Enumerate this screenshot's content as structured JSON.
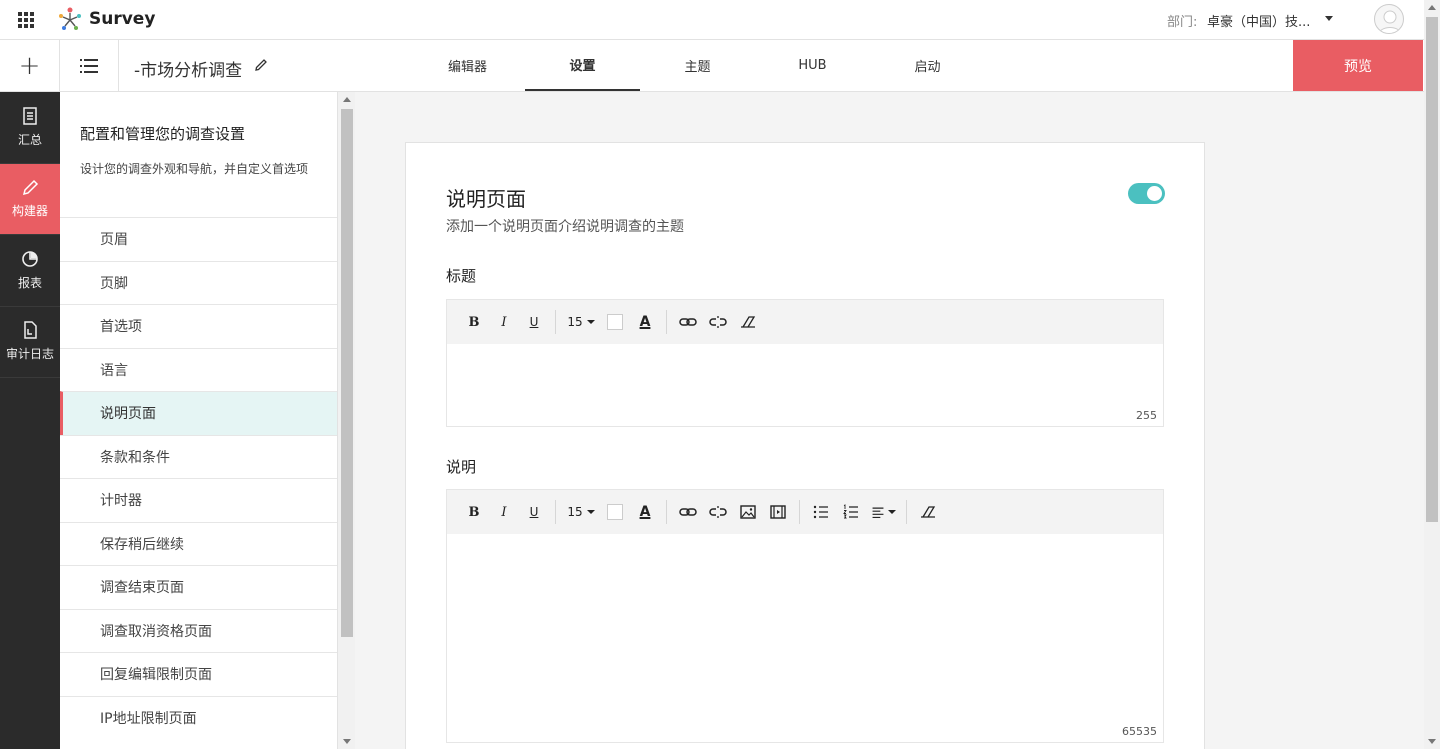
{
  "header": {
    "app_name": "Survey",
    "dept_label": "部门:",
    "dept_value": "卓豪（中国）技..."
  },
  "subbar": {
    "survey_name": "-市场分析调查",
    "tabs": [
      {
        "label": "编辑器"
      },
      {
        "label": "设置"
      },
      {
        "label": "主题"
      },
      {
        "label": "HUB"
      },
      {
        "label": "启动"
      }
    ],
    "active_tab": "设置",
    "preview_label": "预览"
  },
  "rail": {
    "items": [
      {
        "label": "汇总",
        "icon": "document-icon"
      },
      {
        "label": "构建器",
        "icon": "pencil-icon"
      },
      {
        "label": "报表",
        "icon": "pie-chart-icon"
      },
      {
        "label": "审计日志",
        "icon": "log-file-icon"
      }
    ],
    "active": "构建器"
  },
  "panel": {
    "title": "配置和管理您的调查设置",
    "description": "设计您的调查外观和导航，并自定义首选项",
    "menu": [
      {
        "label": "页眉"
      },
      {
        "label": "页脚"
      },
      {
        "label": "首选项"
      },
      {
        "label": "语言"
      },
      {
        "label": "说明页面"
      },
      {
        "label": "条款和条件"
      },
      {
        "label": "计时器"
      },
      {
        "label": "保存稍后继续"
      },
      {
        "label": "调查结束页面"
      },
      {
        "label": "调查取消资格页面"
      },
      {
        "label": "回复编辑限制页面"
      },
      {
        "label": "IP地址限制页面"
      }
    ],
    "active": "说明页面"
  },
  "card": {
    "title": "说明页面",
    "subtitle": "添加一个说明页面介绍说明调查的主题",
    "toggle_on": true,
    "title_field": {
      "label": "标题",
      "font_size": "15",
      "char_limit": "255"
    },
    "desc_field": {
      "label": "说明",
      "font_size": "15",
      "char_limit": "65535"
    }
  },
  "colors": {
    "accent": "#e95d63",
    "toggle": "#4bc0c0",
    "active_menu_bg": "#e5f5f4",
    "rail_bg": "#2b2b2b"
  }
}
